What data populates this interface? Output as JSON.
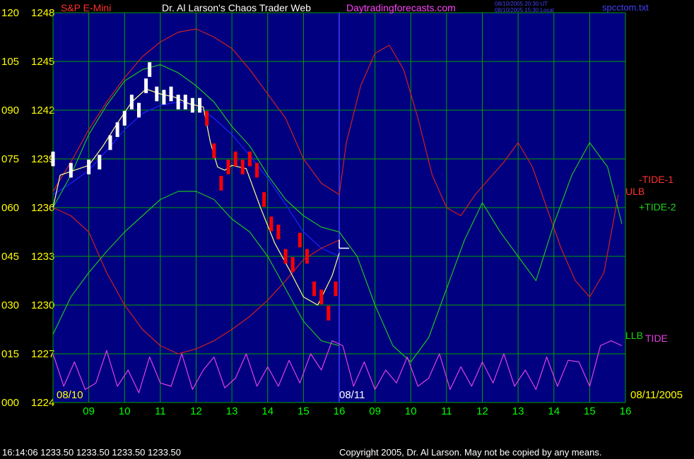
{
  "header": {
    "instrument": "S&P E-Mini",
    "site_title": "Dr. Al Larson's Chaos Trader Web",
    "site_url": "Daytradingforecasts.com",
    "time_ut": "08/10/2005 20:30 UT",
    "time_local": "08/10/2005 15:30 Local",
    "file_name": "spcctom.txt"
  },
  "footer": {
    "last_quote": "16:14:06  1233.50 1233.50 1233.50 1233.50",
    "copyright": "Copyright 2005, Dr. Al Larson. May not be copied by any means."
  },
  "colors": {
    "background": "#000080",
    "grid": "#00a000",
    "price_up": "#ffffff",
    "price_down": "#ff0000",
    "envelope_red": "#d02020",
    "envelope_green": "#20c020",
    "blue_line": "#2020ff",
    "tide_magenta": "#e040e0",
    "axis_text": "#ffff00",
    "time_text": "#00ff00"
  },
  "chart_data": {
    "type": "line",
    "y_ticks_left": [
      "000",
      "015",
      "030",
      "045",
      "060",
      "075",
      "090",
      "105",
      "120"
    ],
    "y_ticks_price": [
      "1224",
      "1227",
      "1230",
      "1233",
      "1236",
      "1239",
      "1242",
      "1245",
      "1248"
    ],
    "price_range": [
      1224,
      1248
    ],
    "x_tick_labels": [
      "09",
      "10",
      "11",
      "12",
      "13",
      "14",
      "15",
      "16",
      "09",
      "10",
      "11",
      "12",
      "13",
      "14",
      "15",
      "16"
    ],
    "date_labels": [
      "08/10",
      "08/11",
      "08/11/2005"
    ],
    "annotations": [
      "-TIDE-1",
      "ULB",
      "+TIDE-2",
      "LLB",
      "TIDE"
    ],
    "series": [
      {
        "name": "",
        "kind": "price_bars",
        "x": [
          8.0,
          8.5,
          9.0,
          9.3,
          9.6,
          9.8,
          10.0,
          10.2,
          10.4,
          10.6,
          10.7,
          10.9,
          11.1,
          11.3,
          11.5,
          11.7,
          11.9,
          12.1,
          12.3,
          12.5,
          12.7,
          12.9,
          13.1,
          13.3,
          13.5,
          13.7,
          13.9,
          14.1,
          14.3,
          14.5,
          14.7,
          14.9,
          15.1,
          15.3,
          15.5,
          15.7,
          15.9
        ],
        "y": [
          1239.0,
          1238.3,
          1238.5,
          1238.8,
          1240.0,
          1240.8,
          1241.5,
          1242.5,
          1242.0,
          1243.5,
          1244.5,
          1243.0,
          1242.8,
          1243.0,
          1242.5,
          1242.5,
          1242.3,
          1242.3,
          1241.5,
          1239.5,
          1237.5,
          1238.5,
          1239.0,
          1238.5,
          1239.0,
          1238.3,
          1236.5,
          1235.0,
          1234.5,
          1233.0,
          1232.5,
          1234.0,
          1233.0,
          1231.0,
          1230.5,
          1229.5,
          1231.0
        ],
        "color": "#ffffff"
      },
      {
        "name": "",
        "kind": "smoothed_price",
        "x": [
          8.0,
          8.2,
          8.6,
          9.0,
          9.4,
          9.8,
          10.2,
          10.6,
          11.0,
          11.4,
          11.8,
          12.2,
          12.4,
          12.6,
          12.8,
          13.0,
          13.4,
          13.8,
          14.2,
          14.6,
          15.0,
          15.4,
          15.8,
          16.0
        ],
        "y": [
          1236.0,
          1238.0,
          1238.3,
          1238.6,
          1239.8,
          1241.2,
          1242.5,
          1243.3,
          1243.0,
          1242.8,
          1242.4,
          1242.2,
          1240.0,
          1238.5,
          1238.3,
          1238.6,
          1238.4,
          1236.0,
          1233.8,
          1232.2,
          1230.5,
          1230.0,
          1231.8,
          1233.2
        ],
        "color": "#ffff80"
      },
      {
        "name": "ULB",
        "kind": "upper_envelope",
        "x": [
          8.0,
          8.5,
          9.0,
          9.5,
          10.0,
          10.5,
          11.0,
          11.5,
          12.0,
          12.5,
          13.0,
          13.5,
          14.0,
          14.5,
          15.0,
          15.5,
          16.0,
          16.2,
          16.6,
          17.0,
          17.4,
          17.8,
          18.2,
          18.6,
          19.0,
          19.4,
          19.8,
          20.2,
          20.6,
          21.0,
          21.4,
          21.8,
          22.2,
          22.6,
          23.0,
          23.4,
          23.8
        ],
        "y": [
          1237.0,
          1238.8,
          1240.8,
          1242.5,
          1244.0,
          1245.3,
          1246.2,
          1246.8,
          1247.0,
          1246.5,
          1245.8,
          1244.5,
          1243.0,
          1241.5,
          1239.0,
          1237.5,
          1236.8,
          1240.0,
          1243.5,
          1245.5,
          1246.0,
          1244.5,
          1241.5,
          1238.0,
          1236.0,
          1235.5,
          1236.8,
          1237.8,
          1238.8,
          1240.0,
          1238.5,
          1236.0,
          1233.5,
          1231.5,
          1230.5,
          1232.0,
          1236.8
        ],
        "color": "#d02020"
      },
      {
        "name": "LLB",
        "kind": "lower_envelope",
        "x": [
          8.0,
          8.5,
          9.0,
          9.5,
          10.0,
          10.5,
          11.0,
          11.5,
          12.0,
          12.5,
          13.0,
          13.5,
          14.0,
          14.5,
          15.0,
          15.5,
          16.0
        ],
        "y": [
          1236.0,
          1235.5,
          1234.5,
          1232.0,
          1230.0,
          1228.5,
          1227.5,
          1227.0,
          1227.3,
          1227.8,
          1228.5,
          1229.3,
          1230.3,
          1231.5,
          1232.8,
          1233.5,
          1234.0
        ],
        "color": "#d02020"
      },
      {
        "name": "+TIDE-2",
        "kind": "green_cycle",
        "x": [
          8.0,
          8.5,
          9.0,
          9.5,
          10.0,
          10.5,
          11.0,
          11.5,
          12.0,
          12.5,
          13.0,
          13.5,
          14.0,
          14.5,
          15.0,
          15.5,
          16.0,
          16.5,
          17.0,
          17.5,
          18.0,
          18.5,
          19.0,
          19.5,
          20.0,
          20.5,
          21.0,
          21.5,
          22.0,
          22.5,
          23.0,
          23.5,
          23.9
        ],
        "y": [
          1236.0,
          1238.0,
          1240.5,
          1242.3,
          1243.8,
          1244.5,
          1244.8,
          1244.3,
          1243.5,
          1242.5,
          1241.0,
          1239.8,
          1238.0,
          1236.5,
          1235.5,
          1234.8,
          1234.5,
          1233.0,
          1230.0,
          1227.5,
          1226.5,
          1228.0,
          1231.0,
          1234.0,
          1236.3,
          1234.5,
          1233.0,
          1231.5,
          1235.0,
          1238.0,
          1240.0,
          1238.5,
          1235.0
        ],
        "color": "#20c020"
      },
      {
        "name": "-TIDE-1",
        "kind": "green_lower",
        "x": [
          8.0,
          8.5,
          9.0,
          9.5,
          10.0,
          10.5,
          11.0,
          11.5,
          12.0,
          12.5,
          13.0,
          13.5,
          14.0,
          14.5,
          15.0,
          15.5,
          16.0
        ],
        "y": [
          1228.2,
          1230.5,
          1232.0,
          1233.3,
          1234.5,
          1235.5,
          1236.5,
          1237.0,
          1237.0,
          1236.5,
          1235.3,
          1234.5,
          1233.0,
          1231.0,
          1229.0,
          1227.8,
          1227.5
        ],
        "color": "#20c020"
      },
      {
        "name": "",
        "kind": "blue_average",
        "x": [
          8.0,
          8.5,
          9.0,
          9.5,
          10.0,
          10.5,
          11.0,
          11.5,
          12.0,
          12.5,
          13.0,
          13.5,
          14.0,
          14.5,
          15.0,
          15.5,
          16.0
        ],
        "y": [
          1236.8,
          1237.5,
          1238.3,
          1239.5,
          1240.8,
          1241.8,
          1242.3,
          1242.5,
          1242.3,
          1241.5,
          1240.5,
          1239.2,
          1237.8,
          1236.2,
          1234.5,
          1233.5,
          1233.0
        ],
        "color": "#2020ff"
      },
      {
        "name": "TIDE",
        "kind": "tide_oscillator",
        "x": [
          8.0,
          8.3,
          8.6,
          8.9,
          9.2,
          9.5,
          9.8,
          10.1,
          10.4,
          10.7,
          11.0,
          11.3,
          11.6,
          11.9,
          12.2,
          12.5,
          12.8,
          13.1,
          13.4,
          13.7,
          14.0,
          14.3,
          14.6,
          14.9,
          15.2,
          15.5,
          15.8,
          16.1,
          16.4,
          16.7,
          17.0,
          17.3,
          17.6,
          17.9,
          18.2,
          18.5,
          18.8,
          19.1,
          19.4,
          19.7,
          20.0,
          20.3,
          20.6,
          20.9,
          21.2,
          21.5,
          21.8,
          22.1,
          22.4,
          22.7,
          23.0,
          23.3,
          23.6,
          23.9
        ],
        "y": [
          1227.0,
          1225.0,
          1226.5,
          1224.8,
          1225.2,
          1227.2,
          1225.0,
          1226.0,
          1224.6,
          1226.8,
          1225.2,
          1225.0,
          1227.0,
          1224.8,
          1226.0,
          1226.8,
          1224.9,
          1225.5,
          1227.0,
          1225.0,
          1226.2,
          1225.0,
          1226.6,
          1225.2,
          1227.0,
          1226.0,
          1227.8,
          1227.5,
          1225.0,
          1226.5,
          1224.8,
          1226.0,
          1225.2,
          1226.8,
          1225.0,
          1225.5,
          1227.0,
          1224.8,
          1226.2,
          1225.0,
          1226.5,
          1225.2,
          1227.0,
          1225.0,
          1226.0,
          1224.8,
          1226.8,
          1225.0,
          1226.6,
          1226.5,
          1225.0,
          1227.5,
          1227.8,
          1227.5
        ],
        "color": "#e040e0"
      }
    ]
  }
}
